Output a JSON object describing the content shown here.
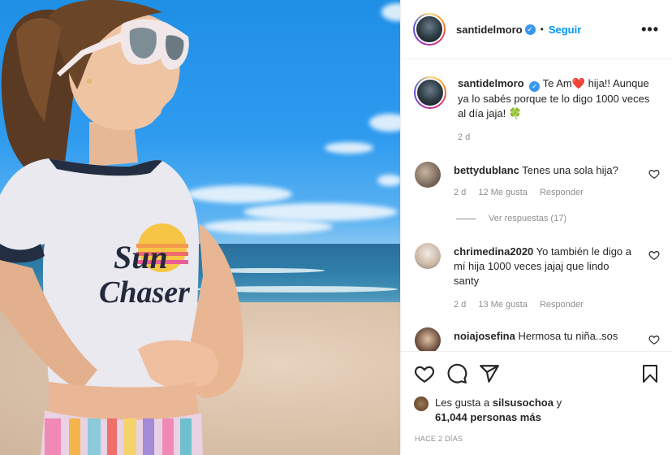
{
  "post": {
    "author": "santidelmoro",
    "follow_label": "Seguir",
    "separator": "•",
    "more_label": "•••",
    "verified_mark": "✓",
    "photo_print_lines": [
      "Sun",
      "Chaser"
    ]
  },
  "caption": {
    "username": "santidelmoro",
    "text_line1": "Te Am",
    "heart_emoji": "❤️",
    "text_line1b": " hija!!",
    "text_rest": "Aunque ya lo sabés porque te lo digo 1000 veces al día jaja! ",
    "clover_emoji": "🍀",
    "time": "2 d"
  },
  "comments": [
    {
      "username": "bettydublanc",
      "text": "Tenes una sola hija?",
      "time": "2 d",
      "likes": "12 Me gusta",
      "reply_label": "Responder",
      "view_replies": "Ver respuestas (17)"
    },
    {
      "username": "chrimedina2020",
      "text": "Yo también le digo a mí hija 1000 veces jajaj que lindo santy",
      "time": "2 d",
      "likes": "13 Me gusta",
      "reply_label": "Responder"
    },
    {
      "username": "noiajosefina",
      "text": "Hermosa tu niña..sos"
    }
  ],
  "likes": {
    "prefix": "Les gusta a ",
    "user": "silsusochoa",
    "middle": " y",
    "count": "61,044 personas más"
  },
  "posted_ago": "HACE 2 DÍAS",
  "icons": [
    "heart-icon",
    "comment-icon",
    "share-icon",
    "bookmark-icon"
  ],
  "colors": {
    "accent": "#0095f6",
    "verified": "#3897f0",
    "heart": "#ed4956"
  }
}
